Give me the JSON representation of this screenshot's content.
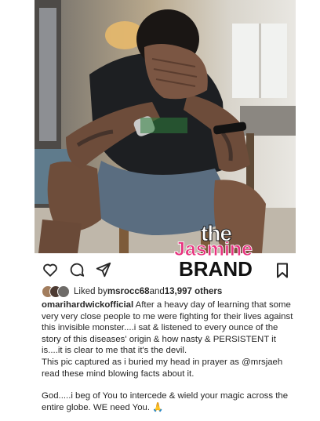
{
  "post": {
    "photo_alt": "",
    "watermark": {
      "line1": "the",
      "line2": "Jasmine",
      "line3": "BRAND"
    },
    "likes": {
      "prefix": "Liked by ",
      "user": "msrocc68",
      "middle": " and ",
      "count": "13,997 others"
    },
    "caption": {
      "username": "omarihardwickofficial",
      "text1": " After a heavy day of learning that some very very close people to me were fighting for their lives against this invisible monster....i sat & listened to every ounce of the story of this diseases' origin & how nasty & PERSISTENT it is....it is clear to me that it's the devil.",
      "text2_pre": "This pic captured as i buried my head in prayer as ",
      "mention": "@mrsjaeh",
      "text2_post": " read these mind blowing facts about it.",
      "text3": "God.....i beg of You to intercede & wield your magic across the entire globe. WE need You. 🙏"
    }
  },
  "icons": [
    "heart-icon",
    "comment-icon",
    "share-icon",
    "bookmark-icon"
  ],
  "colors": {
    "brand_pink": "#e8327f",
    "text": "#262626"
  }
}
